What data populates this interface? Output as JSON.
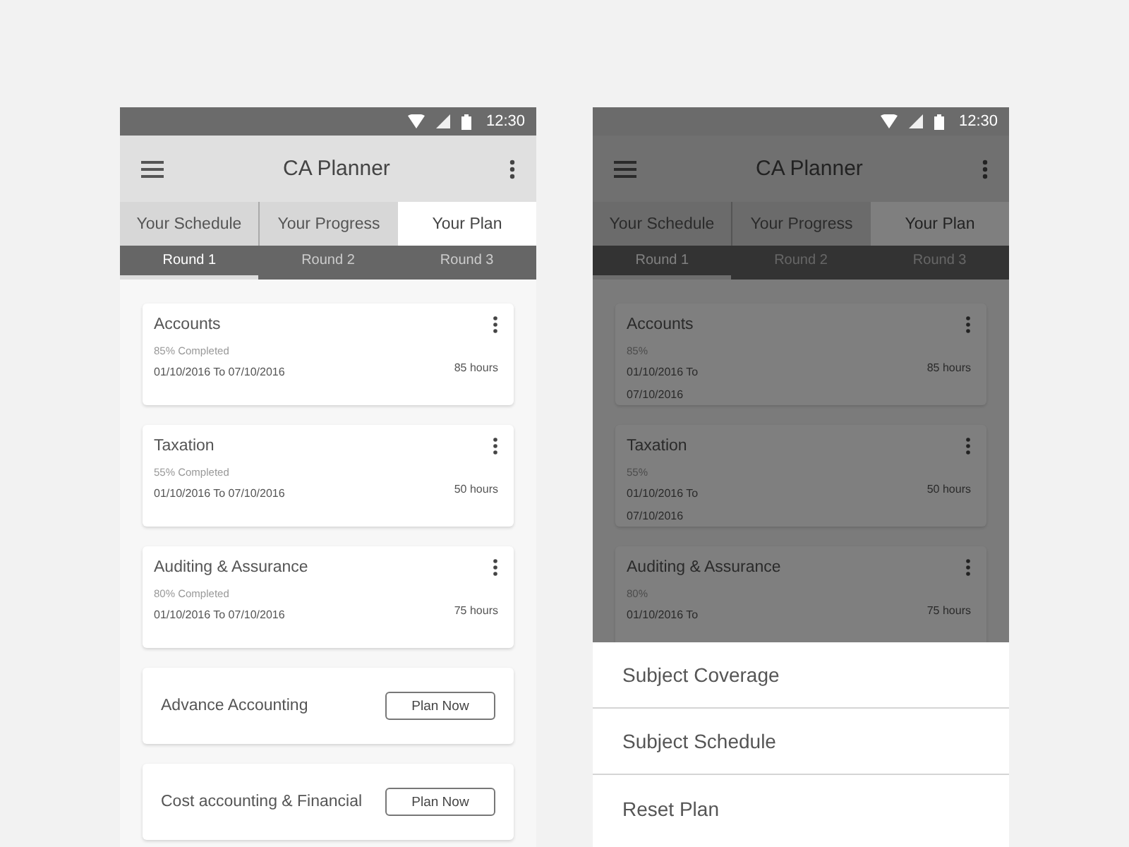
{
  "screens": [
    {
      "status_time": "12:30",
      "title": "CA Planner",
      "dimmed": false,
      "tabs": [
        {
          "label": "Your Schedule",
          "selected": false
        },
        {
          "label": "Your Progress",
          "selected": false
        },
        {
          "label": "Your Plan",
          "selected": true
        }
      ],
      "rounds": [
        {
          "label": "Round 1",
          "selected": true
        },
        {
          "label": "Round 2",
          "selected": false
        },
        {
          "label": "Round 3",
          "selected": false
        }
      ],
      "subjects": [
        {
          "name": "Accounts",
          "progress": "85% Completed",
          "dates": [
            "01/10/2016 To 07/10/2016"
          ],
          "hours": "85 hours"
        },
        {
          "name": "Taxation",
          "progress": "55% Completed",
          "dates": [
            "01/10/2016 To 07/10/2016"
          ],
          "hours": "50 hours"
        },
        {
          "name": "Auditing & Assurance",
          "progress": "80% Completed",
          "dates": [
            "01/10/2016 To 07/10/2016"
          ],
          "hours": "75 hours"
        }
      ],
      "unplanned": [
        {
          "name": "Advance Accounting",
          "button": "Plan Now"
        },
        {
          "name": "Cost accounting & Financial",
          "button": "Plan Now"
        }
      ]
    },
    {
      "status_time": "12:30",
      "title": "CA Planner",
      "dimmed": true,
      "tabs": [
        {
          "label": "Your Schedule",
          "selected": false
        },
        {
          "label": "Your Progress",
          "selected": false
        },
        {
          "label": "Your Plan",
          "selected": true
        }
      ],
      "rounds": [
        {
          "label": "Round 1",
          "selected": true
        },
        {
          "label": "Round 2",
          "selected": false
        },
        {
          "label": "Round 3",
          "selected": false
        }
      ],
      "subjects": [
        {
          "name": "Accounts",
          "progress": "85%",
          "dates": [
            "01/10/2016 To",
            "07/10/2016"
          ],
          "hours": "85 hours"
        },
        {
          "name": "Taxation",
          "progress": "55%",
          "dates": [
            "01/10/2016 To",
            "07/10/2016"
          ],
          "hours": "50 hours"
        },
        {
          "name": "Auditing & Assurance",
          "progress": "80%",
          "dates": [
            "01/10/2016 To"
          ],
          "hours": "75 hours"
        }
      ],
      "bottom_sheet": [
        "Subject Coverage",
        "Subject Schedule",
        "Reset Plan"
      ]
    }
  ]
}
